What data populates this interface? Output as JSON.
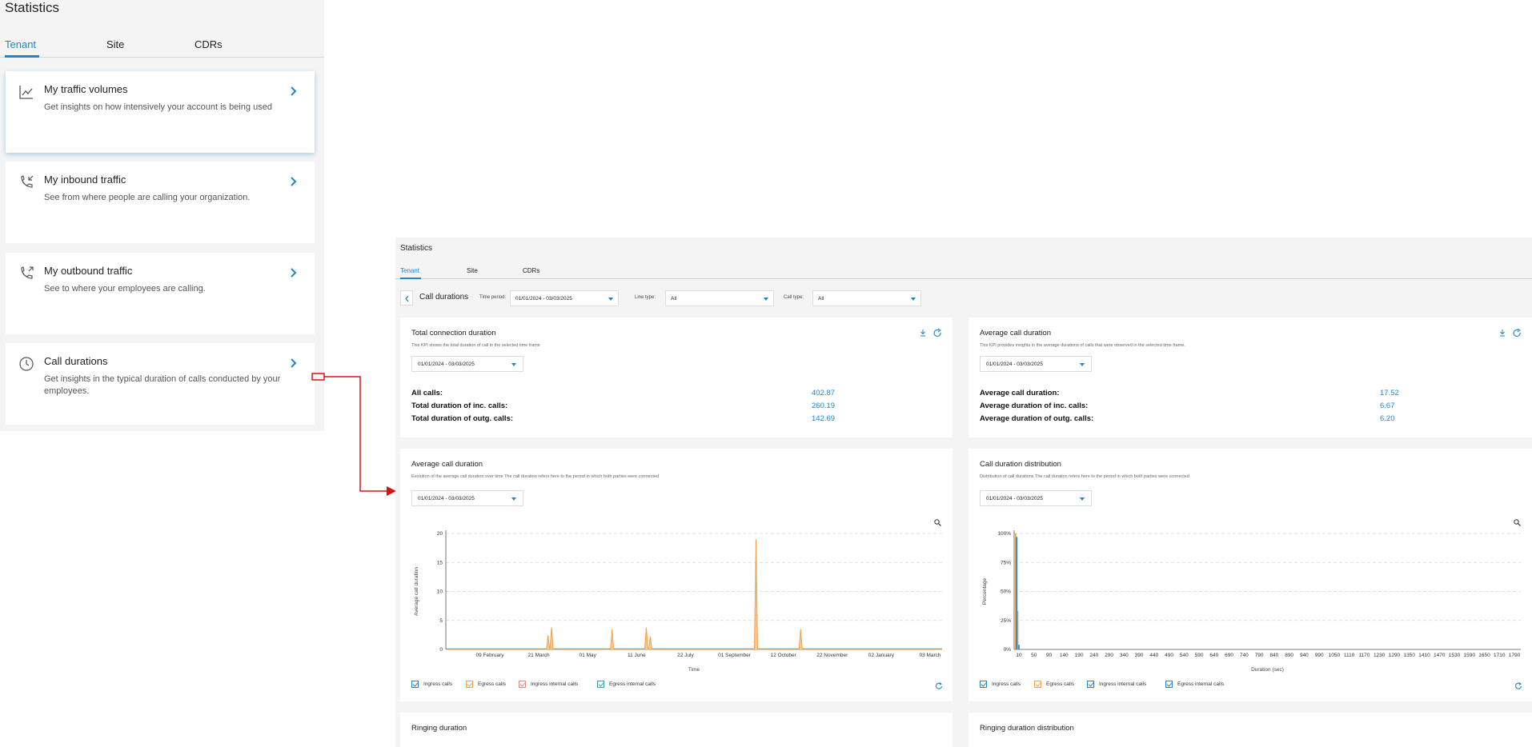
{
  "mobile": {
    "title": "Statistics",
    "tabs": [
      {
        "label": "Tenant"
      },
      {
        "label": "Site"
      },
      {
        "label": "CDRs"
      }
    ],
    "cards": [
      {
        "title": "My traffic volumes",
        "desc": "Get insights on how intensively your account is being used",
        "icon": "chart-line-icon"
      },
      {
        "title": "My inbound traffic",
        "desc": "See from where people are calling your organization.",
        "icon": "phone-incoming-icon"
      },
      {
        "title": "My outbound traffic",
        "desc": "See to where your employees are calling.",
        "icon": "phone-outgoing-icon"
      },
      {
        "title": "Call durations",
        "desc": "Get insights in the typical duration of calls conducted by your employees.",
        "icon": "clock-icon"
      }
    ]
  },
  "desktop": {
    "title": "Statistics",
    "tabs": [
      {
        "label": "Tenant"
      },
      {
        "label": "Site"
      },
      {
        "label": "CDRs"
      }
    ],
    "filter": {
      "page_title": "Call durations",
      "time_period_label": "Time period:",
      "time_period_value": "01/01/2024 - 03/03/2025",
      "line_type_label": "Line type:",
      "line_type_value": "All",
      "call_type_label": "Call type:",
      "call_type_value": "All"
    },
    "total_connection": {
      "title": "Total connection duration",
      "desc": "This KPI shows the total duration of call in the selected time frame",
      "range": "01/01/2024 - 03/03/2025",
      "rows": [
        {
          "label": "All calls:",
          "value": "402.87"
        },
        {
          "label": "Total duration of inc. calls:",
          "value": "260.19"
        },
        {
          "label": "Total duration of outg. calls:",
          "value": "142.69"
        }
      ]
    },
    "average_kpi": {
      "title": "Average call duration",
      "desc": "This KPI provides insights in the average durations of calls that were observed in the selected time frame.",
      "range": "01/01/2024 - 03/03/2025",
      "rows": [
        {
          "label": "Average call duration:",
          "value": "17.52"
        },
        {
          "label": "Average duration of inc. calls:",
          "value": "6.67"
        },
        {
          "label": "Average duration of outg. calls:",
          "value": "6.20"
        }
      ]
    },
    "avg_chart_card": {
      "title": "Average call duration",
      "desc": "Evolution of the average call duration over time The call duration refers here to the period in which both parties were connected",
      "range": "01/01/2024 - 03/03/2025"
    },
    "dist_chart_card": {
      "title": "Call duration distribution",
      "desc": "Distribution of call durations The call duration refers here to the period in which both parties were connected",
      "range": "01/01/2024 - 03/03/2025"
    },
    "legend": [
      {
        "label": "Ingress calls",
        "color": "#1e86c8"
      },
      {
        "label": "Egress calls",
        "color": "#f5a04a"
      },
      {
        "label": "Ingress internal calls",
        "color": "#e88a84"
      },
      {
        "label": "Egress internal calls",
        "color": "#3aa6a0"
      }
    ],
    "bottom_cards": [
      {
        "title": "Ringing duration"
      },
      {
        "title": "Ringing duration distribution"
      }
    ]
  },
  "chart_data": [
    {
      "type": "line",
      "ylabel": "Average call duration",
      "xlabel": "Time",
      "ylim": [
        0,
        20
      ],
      "yticks": [
        "0",
        "5",
        "10",
        "15",
        "20"
      ],
      "xticks": [
        "09 February",
        "21 March",
        "01 May",
        "11 June",
        "22 July",
        "01 September",
        "12 October",
        "22 November",
        "02 January",
        "03 March"
      ],
      "series": [
        {
          "name": "Egress calls",
          "color": "#f5a04a",
          "peaks": [
            {
              "t": 0.206,
              "y": 2.4
            },
            {
              "t": 0.213,
              "y": 3.8
            },
            {
              "t": 0.335,
              "y": 3.5
            },
            {
              "t": 0.404,
              "y": 3.8
            },
            {
              "t": 0.412,
              "y": 2.2
            },
            {
              "t": 0.625,
              "y": 19.0
            },
            {
              "t": 0.715,
              "y": 3.5
            }
          ]
        },
        {
          "name": "Ingress calls",
          "color": "#3aa6a0",
          "peaks": []
        }
      ],
      "grid": true
    },
    {
      "type": "bar",
      "ylabel": "Percentage",
      "xlabel": "Duration (sec)",
      "yticks": [
        "0%",
        "25%",
        "50%",
        "75%",
        "100%"
      ],
      "xticks": [
        "10",
        "50",
        "90",
        "140",
        "190",
        "240",
        "290",
        "340",
        "390",
        "440",
        "490",
        "540",
        "590",
        "640",
        "690",
        "740",
        "790",
        "840",
        "890",
        "940",
        "990",
        "1050",
        "1110",
        "1170",
        "1230",
        "1290",
        "1350",
        "1410",
        "1470",
        "1530",
        "1590",
        "1650",
        "1710",
        "1790"
      ],
      "series": [
        {
          "name": "Egress calls",
          "color": "#f5a04a",
          "values": [
            {
              "x": 0,
              "v": 100
            },
            {
              "x": 10,
              "v": 33
            }
          ]
        },
        {
          "name": "Ingress calls",
          "color": "#1e86c8",
          "values": [
            {
              "x": 5,
              "v": 97
            },
            {
              "x": 15,
              "v": 4
            }
          ]
        }
      ],
      "grid": true
    }
  ]
}
